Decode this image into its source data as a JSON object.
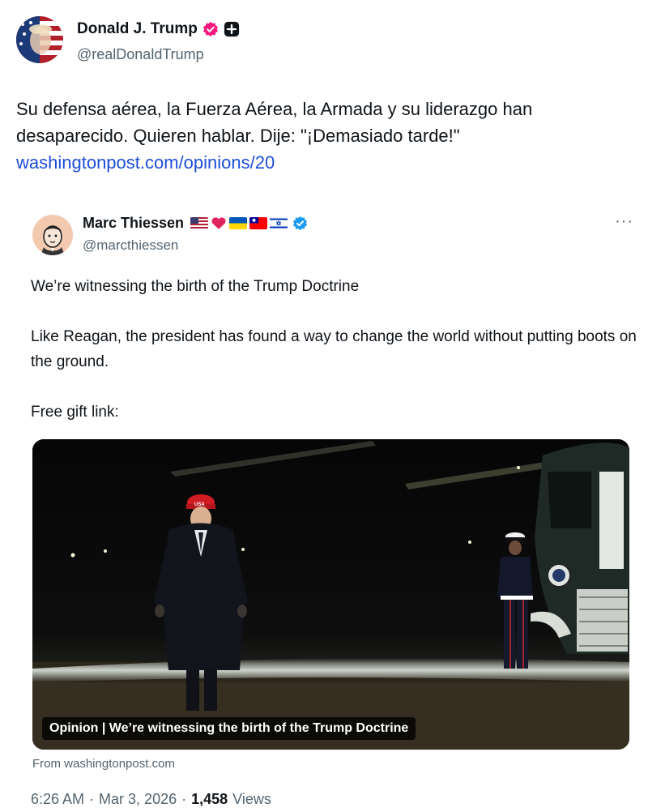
{
  "author": {
    "display_name": "Donald J. Trump",
    "handle": "@realDonaldTrump",
    "verified_color": "#f91880"
  },
  "tweet": {
    "text": "Su defensa aérea, la Fuerza Aérea, la Armada y su liderazgo han desaparecido. Quieren hablar. Dije: \"¡Demasiado tarde!\"",
    "link": "washingtonpost.com/opinions/20",
    "link_color": "#1d4ed8"
  },
  "quote": {
    "display_name": "Marc Thiessen",
    "handle": "@marcthiessen",
    "flags": [
      "us-flag-icon",
      "red-heart-icon",
      "ukraine-flag-icon",
      "taiwan-flag-icon",
      "israel-flag-icon"
    ],
    "verified_color": "#1d9bf0",
    "more_label": "···",
    "paragraphs": [
      "We’re witnessing the birth of the Trump Doctrine",
      "Like Reagan, the president has found a way to change the world without putting boots on the ground.",
      "Free gift link:"
    ],
    "media": {
      "caption": "Opinion | We’re witnessing the birth of the Trump Doctrine",
      "source": "From washingtonpost.com",
      "hat_text": "USA"
    }
  },
  "meta": {
    "time": "6:26 AM",
    "separator": "·",
    "date": "Mar 3, 2026",
    "views_count": "1,458",
    "views_label": "Views"
  }
}
